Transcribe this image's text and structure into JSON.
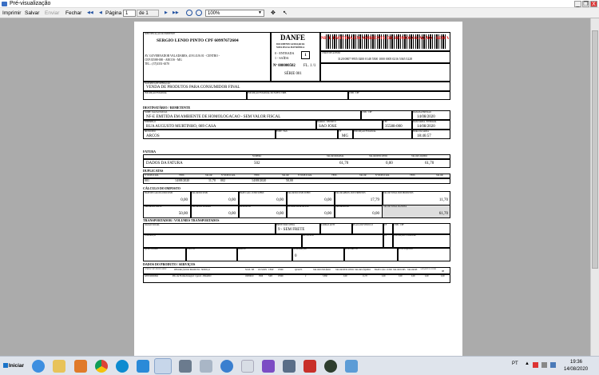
{
  "window": {
    "title": "Pré-visualização",
    "min": "_",
    "max": "❐",
    "close": "X"
  },
  "toolbar": {
    "print": "Imprimir",
    "save": "Salvar",
    "send": "Enviar",
    "close": "Fechar",
    "first": "◀◀",
    "prev": "◀",
    "page_label": "Página",
    "page_value": "1",
    "of_label": "de 1",
    "next": "▶",
    "last": "▶▶",
    "zoom": "100%",
    "zoom_arrow": "▼",
    "move": "✥",
    "pointer": "↖"
  },
  "danfe": {
    "issuer_label": "IDENTIFICAÇÃO DO EMITENTE",
    "issuer_name": "SERGIO LENIO PINTO CPF 60997672604",
    "issuer_addr1": "AV. GOVERNADOR VALADARES, 419 LOJA 01 - CENTRO -",
    "issuer_addr2": "CEP:35588-000 - ARCOS - MG",
    "issuer_phone": "TEL.: (37)3351-6370",
    "title": "DANFE",
    "subtitle1": "DOCUMENTO AUXILIAR DA",
    "subtitle2": "NOTA FISCAL ELETRÔNICA",
    "entry": "0 - ENTRADA",
    "exit": "1 - SAÍDA",
    "type_value": "1",
    "number": "Nº 000000502",
    "sheet": "FL. 1 /1",
    "series": "SÉRIE 001",
    "watermark": "NF-E EMITIDA EM AMBIENTE DE HOMOLOGAÇÃO - SEM VALOR FISCAL",
    "key_label": "CHAVE DE ACESSO",
    "key_value": "3120 0807 9955 0200 0148 5500 1000 0005 0216 5365 5228",
    "nature_label": "NATUREZA DE OPERAÇÃO",
    "nature_value": "VENDA DE PRODUTOS PARA CONSUMIDOR FINAL",
    "ie_label": "INSCRIÇÃO ESTADUAL",
    "ie_st_label": "INSCRIÇÃO ESTADUAL DO SUBST. TRIB.",
    "cnpj_label": "CNPJ / CPF",
    "recipient_section": "DESTINATÁRIO / REMETENTE",
    "r_name_label": "NOME / RAZÃO SOCIAL",
    "r_name_value": "NF-E EMITIDA EM AMBIENTE DE HOMOLOGACAO - SEM VALOR FISCAL",
    "r_cnpj_label": "CNPJ / CPF",
    "r_date_label": "DATA DA EMISSÃO",
    "r_date_value": "14/08/2020",
    "r_addr_label": "ENDEREÇO",
    "r_addr_value": "RUA AUGUSTO MURTINHO, 089 CASA",
    "r_district_label": "BAIRRO / DISTRITO",
    "r_district_value": "SAO JOSE",
    "r_cep_label": "CEP",
    "r_cep_value": "35588-000",
    "r_exitdate_label": "DATA SAÍDA / ENTRADA",
    "r_exitdate_value": "14/08/2020",
    "r_city_label": "MUNICÍPIO",
    "r_city_value": "ARCOS",
    "r_phone_label": "FONE / FAX",
    "r_uf_label": "UF",
    "r_uf_value": "MG",
    "r_ie_label": "INSCRIÇÃO ESTADUAL",
    "r_time_label": "HORA DA SAÍDA",
    "r_time_value": "18:46:57",
    "invoice_section": "FATURA",
    "inv_number_label": "NÚMERO",
    "inv_orig_label": "VALOR ORIGINAL",
    "inv_disc_label": "VALOR DESCONTO",
    "inv_net_label": "VALOR LÍQUIDO",
    "inv_data_label": "DADOS DA FATURA",
    "inv_number_value": "502",
    "inv_orig_value": "61,70",
    "inv_disc_value": "0,00",
    "inv_net_value": "61,70",
    "dup_section": "DUPLICATAS",
    "dup_headers": [
      "Nº DUPLICATA",
      "VENC.",
      "VALOR",
      "Nº DUPLICATA",
      "VENC.",
      "VALOR",
      "Nº DUPLICATA",
      "VENC.",
      "VALOR",
      "Nº DUPLICATA",
      "VENC.",
      "VALOR"
    ],
    "dup_row": [
      "001",
      "14/08/2020",
      "11,70",
      "002",
      "14/08/2020",
      "50,00"
    ],
    "tax_section": "CÁLCULO DO IMPOSTO",
    "tax_row1_labels": [
      "BASE DE CÁLCULO DO ICMS",
      "VALOR DO ICMS",
      "BASE CÁLC. ICMS SUBST.",
      "VALOR DO ICMS SUBST.",
      "VALOR APROX. DOS TRIBUTOS",
      "VALOR TOTAL DOS PRODUTOS"
    ],
    "tax_row1_values": [
      "0,00",
      "0,00",
      "0,00",
      "0,00",
      "17,79",
      "11,70"
    ],
    "tax_row2_labels": [
      "VALOR DO FRETE",
      "VALOR DO SEGURO",
      "DESCONTO",
      "OUTRAS DESP. ACESS.",
      "VALOR DO IPI",
      "VALOR TOTAL DA NOTA"
    ],
    "tax_row2_values": [
      "50,00",
      "0,00",
      "0,00",
      "0,00",
      "0,00",
      "61,70"
    ],
    "transport_section": "TRANSPORTADOR / VOLUMES TRANSPORTADOS",
    "t_name_label": "RAZÃO SOCIAL",
    "t_freight_label": "FRETE POR CONTA",
    "t_freight_value": "9 - SEM FRETE",
    "t_antt_label": "CÓDIGO ANTT",
    "t_plate_label": "PLACA DO VEÍCULO",
    "t_uf_label": "UF",
    "t_cnpj_label": "CNPJ / CPF",
    "t_addr_label": "ENDEREÇO",
    "t_city_label": "MUNICÍPIO",
    "t_uf2_label": "UF",
    "t_ie_label": "INSCRIÇÃO ESTADUAL",
    "t_qty_label": "QUANTIDADE",
    "t_kind_label": "ESPÉCIE",
    "t_brand_label": "MARCA",
    "t_num_label": "NUMERAÇÃO",
    "t_num_value": "0",
    "t_gross_label": "PESO BRUTO",
    "t_net_label": "PESO LÍQUIDO",
    "products_section": "DADOS DO PRODUTO / SERVIÇOS",
    "prod_headers": [
      "CÓDIGO DO PROD./SERV.",
      "DESCRIÇÃO DO PRODUTO / SERVIÇO",
      "NCM / SH",
      "O/CSOSN",
      "CFOP",
      "UNID",
      "QUANT.",
      "VALOR UNITÁRIO",
      "VALOR DESCONTO",
      "VALOR LÍQUIDO",
      "BASE CÁLC. ICMS",
      "VALOR ICMS",
      "VALOR IPI",
      "ALÍQUOTAS ICMS",
      "IPI"
    ],
    "prod_row": [
      "0205190002664",
      "Pão de Forma Integral 1 geral - PRADO",
      "19059010",
      "0500",
      "5405",
      "UNID",
      "2",
      "5,850",
      "0,00",
      "11,70",
      "0,00",
      "0,00",
      "0,00",
      "0,00",
      "0,00"
    ]
  },
  "taskbar": {
    "start": "Iniciar",
    "lang": "PT",
    "time": "19:36",
    "date": "14/08/2020"
  }
}
